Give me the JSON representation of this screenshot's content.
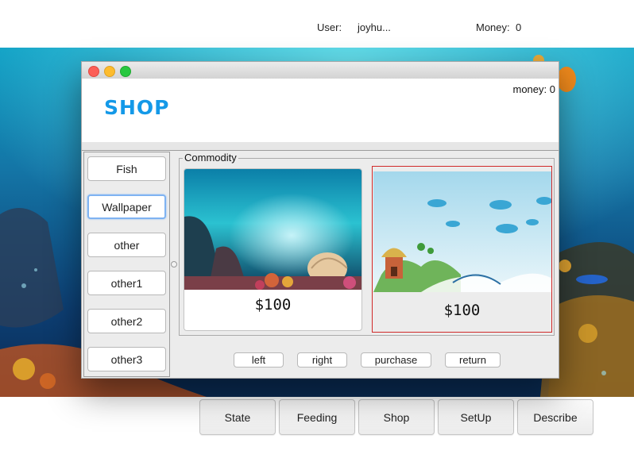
{
  "topbar": {
    "user_label": "User:",
    "user_value": "joyhu...",
    "money_label": "Money:",
    "money_value": "0"
  },
  "bottom_tabs": [
    "State",
    "Feeding",
    "Shop",
    "SetUp",
    "Describe"
  ],
  "shop_window": {
    "title": "SHOP",
    "money_label": "money:",
    "money_value": "0",
    "side_menu": [
      {
        "label": "Fish",
        "selected": false
      },
      {
        "label": "Wallpaper",
        "selected": true
      },
      {
        "label": "other",
        "selected": false
      },
      {
        "label": "other1",
        "selected": false
      },
      {
        "label": "other2",
        "selected": false
      },
      {
        "label": "other3",
        "selected": false
      }
    ],
    "commodity_legend": "Commodity",
    "items": [
      {
        "price": "$100",
        "picture": "underwater-reef-wallpaper",
        "selected": false
      },
      {
        "price": "$100",
        "picture": "dolphins-mushroom-house-wallpaper",
        "selected": true
      }
    ],
    "actions": [
      "left",
      "right",
      "purchase",
      "return"
    ]
  },
  "colors": {
    "shop_title": "#1499e8",
    "selection_border": "#d02a2a",
    "focus_ring": "#7fb3f2",
    "close": "#fc5f57",
    "minimize": "#fdbc2e",
    "zoom": "#28c840"
  }
}
